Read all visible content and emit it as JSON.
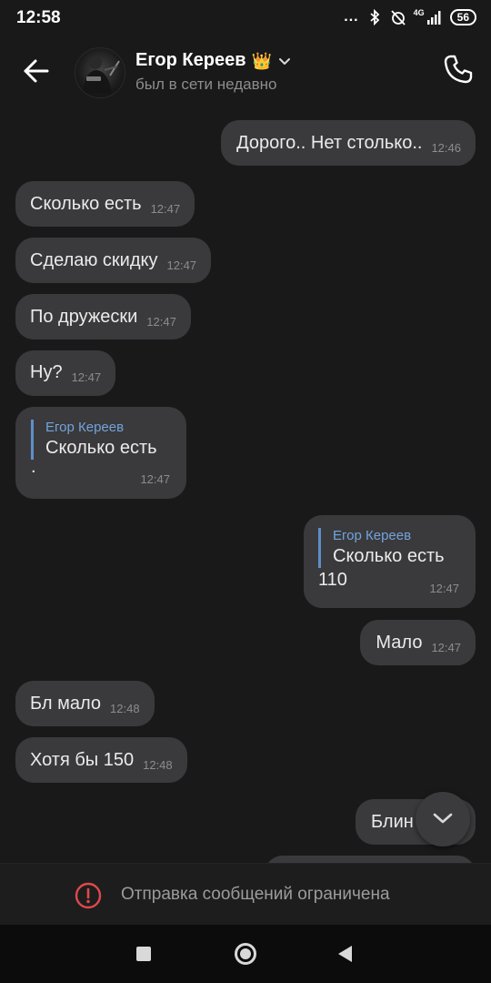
{
  "statusbar": {
    "time": "12:58",
    "dots": "...",
    "network": "4G",
    "battery": "56"
  },
  "header": {
    "name": "Егор Кереев",
    "badge": "👑",
    "status": "был в сети недавно"
  },
  "messages": [
    {
      "side": "out",
      "text": "Дорого.. Нет столько..",
      "time": "12:46"
    },
    {
      "side": "in",
      "text": "Сколько есть",
      "time": "12:47"
    },
    {
      "side": "in",
      "text": "Сделаю скидку",
      "time": "12:47"
    },
    {
      "side": "in",
      "text": "По дружески",
      "time": "12:47"
    },
    {
      "side": "in",
      "text": "Ну?",
      "time": "12:47"
    },
    {
      "side": "in",
      "reply_author": "Егор Кереев",
      "reply_text": "Сколько есть",
      "text": ".",
      "time": "12:47"
    },
    {
      "side": "out",
      "reply_author": "Егор Кереев",
      "reply_text": "Сколько есть",
      "text": "110",
      "time": "12:47"
    },
    {
      "side": "out",
      "text": "Мало",
      "time": "12:47"
    },
    {
      "side": "in",
      "text": "Бл мало",
      "time": "12:48"
    },
    {
      "side": "in",
      "text": "Хотя бы 150",
      "time": "12:48"
    },
    {
      "side": "out",
      "text": "Блин",
      "time": ""
    }
  ],
  "restricted": {
    "text": "Отправка сообщений ограничена"
  },
  "colors": {
    "background": "#19191a",
    "bubble": "#3a3a3c",
    "quote_accent": "#72a3dd",
    "warning": "#e0494b"
  },
  "icons": [
    "back-arrow-icon",
    "chevron-down-icon",
    "phone-icon",
    "scroll-down-icon",
    "warning-icon",
    "nav-recents-icon",
    "nav-home-icon",
    "nav-back-icon"
  ]
}
